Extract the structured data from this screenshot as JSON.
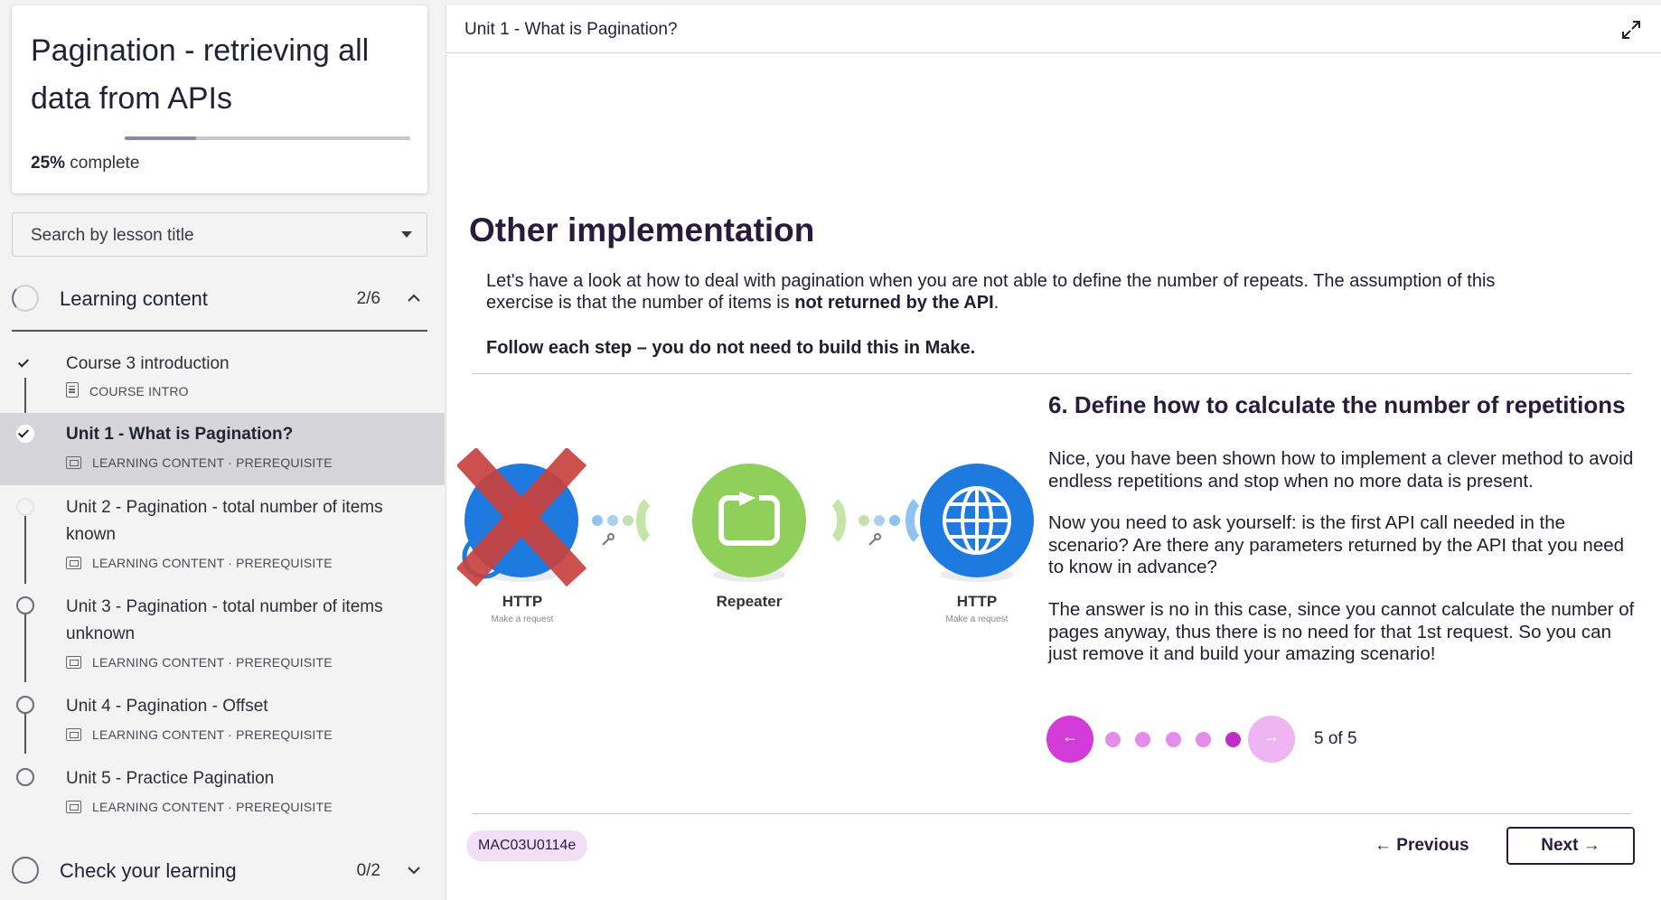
{
  "course": {
    "title": "Pagination - retrieving all data from APIs",
    "progress_percent": "25%",
    "progress_suffix": " complete",
    "progress_fraction": 0.25
  },
  "search": {
    "placeholder": "Search by lesson title"
  },
  "sections": [
    {
      "title": "Learning content",
      "count": "2/6",
      "expanded": true
    },
    {
      "title": "Check your learning",
      "count": "0/2",
      "expanded": false
    }
  ],
  "lessons": [
    {
      "title": "Course 3 introduction",
      "meta": "COURSE INTRO",
      "completed": true,
      "active": false
    },
    {
      "title": "Unit 1 - What is Pagination?",
      "meta": "LEARNING CONTENT · PREREQUISITE",
      "completed": true,
      "active": true
    },
    {
      "title": "Unit 2 - Pagination - total number of items known",
      "meta": "LEARNING CONTENT · PREREQUISITE",
      "completed": false,
      "active": false
    },
    {
      "title": "Unit 3 - Pagination - total number of items unknown",
      "meta": "LEARNING CONTENT · PREREQUISITE",
      "completed": false,
      "active": false
    },
    {
      "title": "Unit 4 - Pagination - Offset",
      "meta": "LEARNING CONTENT · PREREQUISITE",
      "completed": false,
      "active": false
    },
    {
      "title": "Unit 5 - Practice Pagination",
      "meta": "LEARNING CONTENT · PREREQUISITE",
      "completed": false,
      "active": false
    }
  ],
  "main": {
    "header_title": "Unit 1 - What is Pagination?",
    "slide_title": "Other implementation",
    "intro_text": "Let's have a look at how to deal with pagination when you are not able to define the number of repeats. The assumption of this exercise is that the number of items is ",
    "intro_bold": "not returned by the API",
    "intro_end": ".",
    "follow_text": "Follow each step – you do not need to build this in Make.",
    "step_title": "6. Define how to calculate the number of repetitions",
    "step_paragraphs": [
      "Nice, you have been shown how to implement a clever method to avoid endless repetitions and stop when no more data is present.",
      "Now you need to ask yourself: is the first API call needed in the scenario? Are there any parameters returned by the API that you need to know in advance?",
      "The answer is no in this case, since you cannot calculate the number of pages anyway, thus there is no need for that 1st request. So you can just remove it and build your amazing scenario!"
    ],
    "diagram": {
      "modules": [
        {
          "name": "HTTP",
          "sub": "Make a request",
          "color": "#1f7ae0",
          "crossed": true
        },
        {
          "name": "Repeater",
          "sub": "",
          "color": "#8ed05a",
          "crossed": false
        },
        {
          "name": "HTTP",
          "sub": "Make a request",
          "color": "#1f7ae0",
          "crossed": false
        }
      ]
    },
    "pager": {
      "current": 5,
      "total": 5,
      "label": "5 of 5"
    },
    "code_badge": "MAC03U0114e",
    "prev_label": "Previous",
    "next_label": "Next"
  },
  "colors": {
    "accent": "#d23bd8",
    "navy": "#2a1b3d",
    "http_blue": "#1f7ae0",
    "repeater_green": "#8ed05a",
    "cross_red": "#c8423e"
  }
}
